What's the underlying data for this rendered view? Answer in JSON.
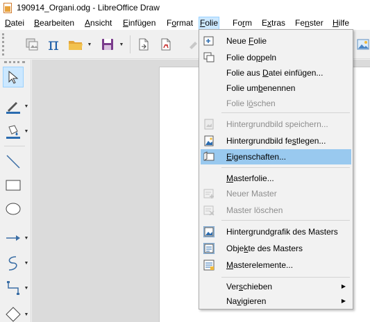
{
  "window": {
    "title": "190914_Organi.odg - LibreOffice Draw"
  },
  "menubar": {
    "items": [
      {
        "label": "Datei",
        "accel": "D",
        "active": false
      },
      {
        "label": "Bearbeiten",
        "accel": "B",
        "active": false
      },
      {
        "label": "Ansicht",
        "accel": "A",
        "active": false
      },
      {
        "label": "Einfügen",
        "accel": "E",
        "active": false
      },
      {
        "label": "Format",
        "accel": "o",
        "active": false
      },
      {
        "label": "Folie",
        "accel": "F",
        "active": true
      },
      {
        "label": "Form",
        "accel": "r",
        "active": false
      },
      {
        "label": "Extras",
        "accel": "x",
        "active": false
      },
      {
        "label": "Fenster",
        "accel": "n",
        "active": false
      },
      {
        "label": "Hilfe",
        "accel": "H",
        "active": false
      }
    ]
  },
  "toolbar": {
    "buttons": [
      "image-gallery-icon",
      "formula-pi-icon",
      "open-folder-icon",
      "save-icon",
      "export-icon",
      "export-pdf-icon",
      "clone-format-icon",
      "insert-image-icon"
    ]
  },
  "sidebar": {
    "tools": [
      "select-tool",
      "line-color-tool",
      "fill-color-tool",
      "line-tool",
      "rectangle-tool",
      "ellipse-tool",
      "arrow-line-tool",
      "curve-tool",
      "connector-tool",
      "diamond-shape-tool"
    ]
  },
  "folie_menu": {
    "items": [
      {
        "label": "Neue Folie",
        "accel": "F",
        "icon": "new-slide-icon",
        "disabled": false
      },
      {
        "label": "Folie doppeln",
        "accel": "p",
        "icon": "duplicate-slide-icon",
        "disabled": false
      },
      {
        "label": "Folie aus Datei einfügen...",
        "accel": "D",
        "icon": "",
        "disabled": false
      },
      {
        "label": "Folie umbenennen",
        "accel": "b",
        "icon": "",
        "disabled": false
      },
      {
        "label": "Folie löschen",
        "accel": "ö",
        "icon": "",
        "disabled": true
      },
      {
        "label": "Hintergrundbild speichern...",
        "accel": "",
        "icon": "save-background-icon",
        "disabled": true
      },
      {
        "label": "Hintergrundbild festlegen...",
        "accel": "s",
        "icon": "set-background-icon",
        "disabled": false
      },
      {
        "label": "Eigenschaften...",
        "accel": "E",
        "icon": "properties-icon",
        "disabled": false,
        "highlight": true
      },
      {
        "label": "Masterfolie...",
        "accel": "M",
        "icon": "",
        "disabled": false
      },
      {
        "label": "Neuer Master",
        "accel": "",
        "icon": "new-master-icon",
        "disabled": true
      },
      {
        "label": "Master löschen",
        "accel": "",
        "icon": "delete-master-icon",
        "disabled": true
      },
      {
        "label": "Hintergrundgrafik des Masters",
        "accel": "g",
        "icon": "master-background-icon",
        "disabled": false
      },
      {
        "label": "Objekte des Masters",
        "accel": "k",
        "icon": "master-objects-icon",
        "disabled": false
      },
      {
        "label": "Masterelemente...",
        "accel": "M",
        "icon": "master-elements-icon",
        "disabled": false
      },
      {
        "label": "Verschieben",
        "accel": "s",
        "icon": "",
        "disabled": false,
        "submenu": true
      },
      {
        "label": "Navigieren",
        "accel": "v",
        "icon": "",
        "disabled": false,
        "submenu": true
      }
    ]
  },
  "colors": {
    "highlight": "#99c9ef",
    "active_menu": "#cce8ff",
    "menu_bg": "#f2f2f2",
    "disabled_text": "#8d8d8d"
  }
}
